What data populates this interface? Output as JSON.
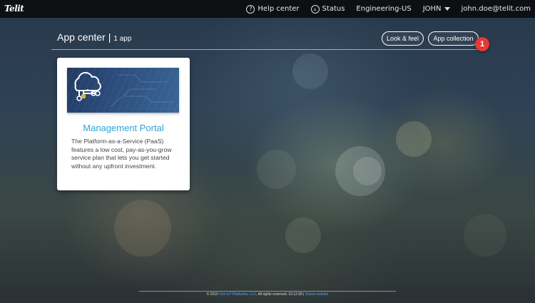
{
  "topbar": {
    "logo": "Telit",
    "help_label": "Help center",
    "help_icon": "question-circle-icon",
    "status_label": "Status",
    "status_icon": "triangle-circle-icon",
    "org_label": "Engineering-US",
    "user_label": "JOHN",
    "email_label": "john.doe@telit.com"
  },
  "header": {
    "title": "App center",
    "separator": "|",
    "count": "1 app",
    "look_feel_label": "Look & feel",
    "app_collection_label": "App collection",
    "badge": "1",
    "badge_color": "#e53935"
  },
  "apps": [
    {
      "title": "Management Portal",
      "icon": "cloud-network-icon",
      "description": "The Platform-as-a-Service (PaaS) features a low cost, pay-as-you-grow service plan that lets you get started without any upfront investment.",
      "title_color": "#2aa6d6"
    }
  ],
  "footer": {
    "prefix": "© 2019",
    "company_link": "Telit IoT Platforms, LLC",
    "rights": ". All rights reserved. 10.12.00 |",
    "status_link": "Status website"
  }
}
